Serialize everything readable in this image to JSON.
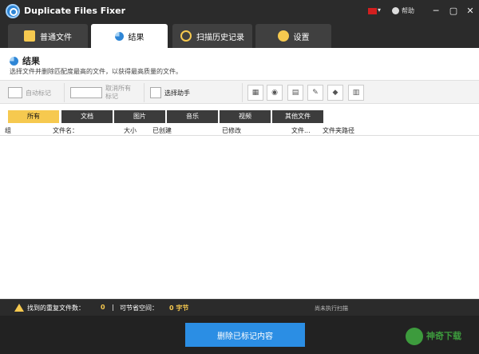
{
  "app": {
    "title": "Duplicate Files Fixer",
    "help_label": "帮助",
    "controls": {
      "minimize": "─",
      "restore": "▢",
      "close": "✕",
      "caret": "▾"
    }
  },
  "tabs": [
    {
      "label": "普通文件",
      "icon": "document-icon",
      "active": false
    },
    {
      "label": "结果",
      "icon": "pie-chart-icon",
      "active": true
    },
    {
      "label": "扫描历史记录",
      "icon": "history-icon",
      "active": false
    },
    {
      "label": "设置",
      "icon": "gear-icon",
      "active": false
    }
  ],
  "page": {
    "title": "结果",
    "subtitle": "选择文件并删除匹配度最高的文件，以获得最高质量的文件。"
  },
  "toolbar": {
    "auto_mark": "自动标记",
    "unmark_all": "取消所有标记",
    "select_assistant": "选择助手"
  },
  "filters": [
    "所有",
    "文档",
    "图片",
    "音乐",
    "视频",
    "其他文件"
  ],
  "columns": [
    "组",
    "文件名：",
    "大小",
    "已创建",
    "已修改",
    "文件...",
    "文件夹路径"
  ],
  "status": {
    "found_label": "找到的重复文件数：",
    "found_value": "0",
    "sep": "|",
    "space_label": "可节省空间：",
    "space_value": "0 字节",
    "scan_state": "尚未执行扫描"
  },
  "footer": {
    "delete_marked": "删除已标记内容",
    "watermark": "神奇下载"
  },
  "colors": {
    "accent": "#2b8ee4",
    "filter_active": "#f6c94f",
    "chrome": "#2b2b2b"
  }
}
